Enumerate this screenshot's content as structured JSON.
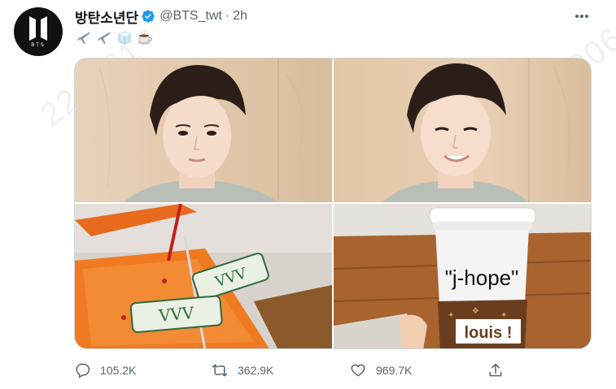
{
  "watermark": "220061",
  "account": {
    "avatar_text": "BTS",
    "display_name": "방탄소년단",
    "handle": "@BTS_twt",
    "separator": "·",
    "time": "2h",
    "verified": true
  },
  "tweet": {
    "emojis": [
      "airplane",
      "airplane",
      "ice-cube",
      "hot-beverage"
    ]
  },
  "media": {
    "count": 4,
    "cup_label": "\"j-hope\"",
    "sleeve_text": "louis !"
  },
  "actions": {
    "replies": "105.2K",
    "retweets": "362.9K",
    "likes": "969.7K"
  },
  "colors": {
    "accent": "#1d9bf0",
    "muted": "#536471",
    "border": "#cfd9de",
    "text": "#0f1419"
  }
}
